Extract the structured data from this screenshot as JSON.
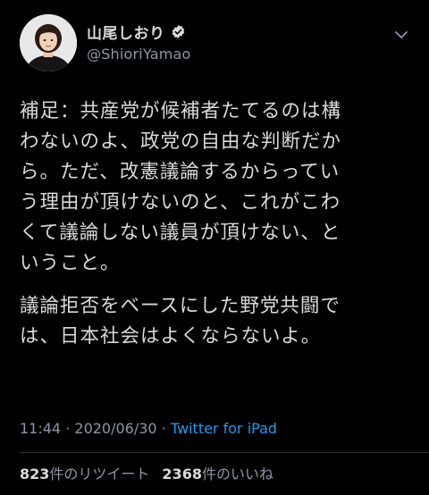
{
  "tweet": {
    "author": {
      "display_name": "山尾しおり",
      "handle": "@ShioriYamao",
      "verified": true
    },
    "paragraphs": [
      "補足：共産党が候補者たてるのは構\nわないのよ、政党の自由な判断だか\nら。ただ、改憲議論するからってい\nう理由が頂けないのと、これがこわ\nくて議論しない議員が頂けない、と\nいうこと。",
      "議論拒否をベースにした野党共闘で\nは、日本社会はよくならないよ。"
    ],
    "time": "11:44",
    "separator": "·",
    "date": "2020/06/30",
    "source": "Twitter for iPad"
  },
  "stats": {
    "retweets_count": "823",
    "retweets_label": "件のリツイート",
    "likes_count": "2368",
    "likes_label": "件のいいね"
  },
  "icons": {
    "verified": "verified-badge-icon",
    "menu": "chevron-down-icon"
  },
  "colors": {
    "background": "#000000",
    "text": "#d9d9d9",
    "secondary": "#8b98a5",
    "link": "#1d9bf0",
    "divider": "#2f3336"
  }
}
